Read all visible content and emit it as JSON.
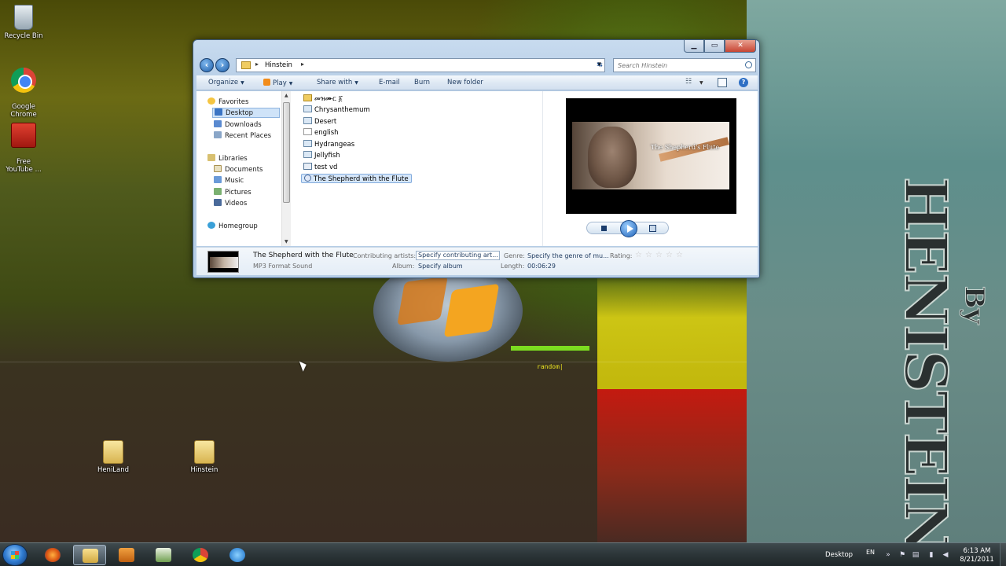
{
  "desktop": {
    "icons": [
      {
        "label": "Recycle Bin",
        "icon": "recycle-bin-icon"
      },
      {
        "label": "Google\nChrome",
        "icon": "chrome-icon"
      },
      {
        "label": "Free\nYouTube ...",
        "icon": "youtube-downloader-icon"
      },
      {
        "label": "HeniLand",
        "icon": "folder-icon"
      },
      {
        "label": "Hinstein",
        "icon": "folder-icon"
      }
    ],
    "wallpaper": {
      "random_text": "random|",
      "by_text": "By",
      "brand_text": "HENISTEIN"
    }
  },
  "explorer": {
    "address_path": "Hinstein",
    "search_placeholder": "Search Hinstein",
    "toolbar": {
      "organize": "Organize",
      "play": "Play",
      "share_with": "Share with",
      "email": "E-mail",
      "burn": "Burn",
      "new_folder": "New folder"
    },
    "nav": {
      "favorites": "Favorites",
      "desktop": "Desktop",
      "downloads": "Downloads",
      "recent_places": "Recent Places",
      "libraries": "Libraries",
      "documents": "Documents",
      "music": "Music",
      "pictures": "Pictures",
      "videos": "Videos",
      "homegroup": "Homegroup"
    },
    "files": [
      {
        "name": "መዝሙር ፩",
        "type": "folder"
      },
      {
        "name": "Chrysanthemum",
        "type": "image"
      },
      {
        "name": "Desert",
        "type": "image"
      },
      {
        "name": "english",
        "type": "document"
      },
      {
        "name": "Hydrangeas",
        "type": "image"
      },
      {
        "name": "Jellyfish",
        "type": "image"
      },
      {
        "name": "test vd",
        "type": "video"
      },
      {
        "name": "The Shepherd with the Flute",
        "type": "audio",
        "selected": true
      }
    ],
    "preview": {
      "video_title": "The Shepherd's Flute"
    },
    "details": {
      "title": "The Shepherd with the Flute",
      "format": "MP3 Format Sound",
      "contributing_artists_label": "Contributing artists:",
      "contributing_artists_value": "Specify contributing art...",
      "album_label": "Album:",
      "album_value": "Specify album",
      "genre_label": "Genre:",
      "genre_value": "Specify the genre of mu...",
      "length_label": "Length:",
      "length_value": "00:06:29",
      "rating_label": "Rating:",
      "rating_stars": 0
    }
  },
  "taskbar": {
    "apps": [
      "firefox-icon",
      "explorer-icon",
      "media-player-icon",
      "chart-app-icon",
      "chrome-icon",
      "ie-icon"
    ],
    "tray": {
      "desktop_label": "Desktop",
      "language": "EN",
      "time": "6:13 AM",
      "date": "8/21/2011"
    }
  },
  "colors": {
    "window_frame": "#b6cde6",
    "selection": "#d6e7fa",
    "taskbar": "#2c3538"
  }
}
